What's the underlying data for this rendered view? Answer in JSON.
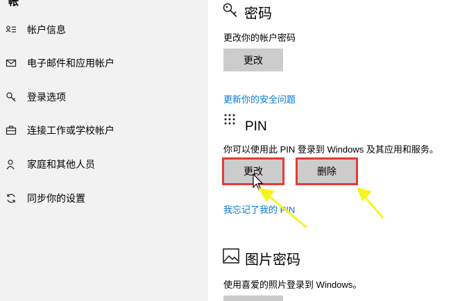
{
  "sidebar": {
    "cut_title": "帐",
    "items": [
      {
        "label": "帐户信息",
        "icon": "account-info-icon"
      },
      {
        "label": "电子邮件和应用帐户",
        "icon": "mail-icon"
      },
      {
        "label": "登录选项",
        "icon": "key-icon"
      },
      {
        "label": "连接工作或学校帐户",
        "icon": "briefcase-icon"
      },
      {
        "label": "家庭和其他人员",
        "icon": "person-icon"
      },
      {
        "label": "同步你的设置",
        "icon": "sync-icon"
      }
    ]
  },
  "password": {
    "title": "密码",
    "icon": "key-icon",
    "description": "更改你的帐户密码",
    "change_label": "更改",
    "security_link": "更新你的安全问题"
  },
  "pin": {
    "title": "PIN",
    "icon": "pin-keypad-icon",
    "description": "你可以使用此 PIN 登录到 Windows 及其应用和服务。",
    "change_label": "更改",
    "remove_label": "删除",
    "forgot_link": "我忘记了我的 PIN"
  },
  "picture_password": {
    "title": "图片密码",
    "icon": "picture-icon",
    "description": "使用喜爱的照片登录到 Windows。"
  },
  "colors": {
    "sidebar_bg": "#f2f2f2",
    "accent_link": "#0078d7",
    "button_bg": "#cccccc",
    "highlight": "#e53935",
    "arrow": "#f5f51e"
  }
}
